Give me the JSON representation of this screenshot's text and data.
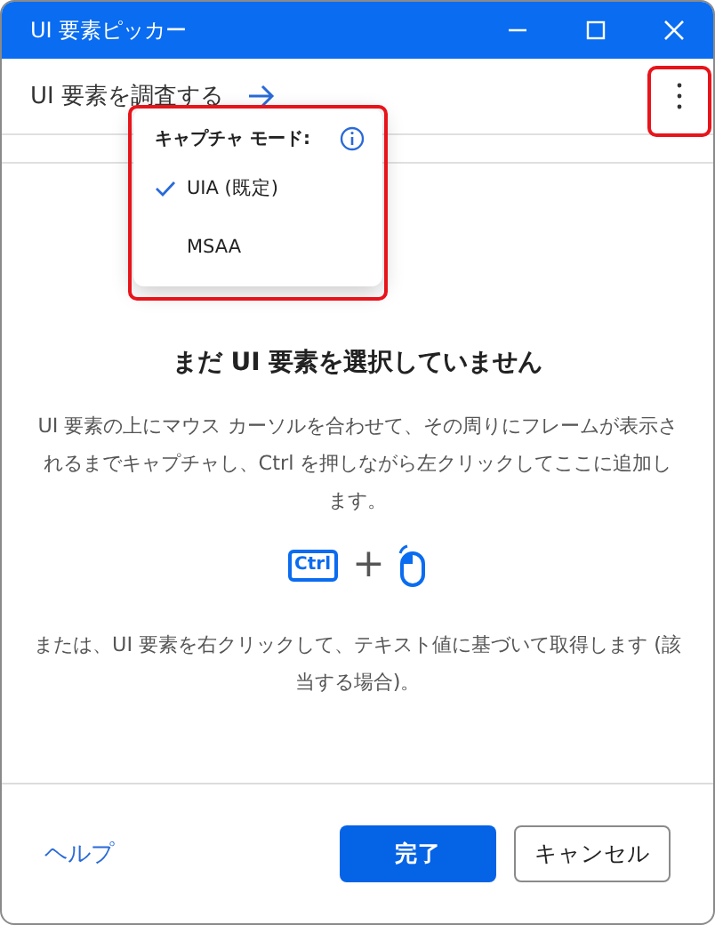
{
  "window": {
    "title": "UI 要素ピッカー"
  },
  "toolbar": {
    "inspect_link": "UI 要素を調査する"
  },
  "menu": {
    "heading": "キャプチャ モード:",
    "items": [
      {
        "label": "UIA (既定)",
        "selected": true
      },
      {
        "label": "MSAA",
        "selected": false
      }
    ]
  },
  "empty_state": {
    "title": "まだ UI 要素を選択していません",
    "instructions": "UI 要素の上にマウス カーソルを合わせて、その周りにフレームが表示されるまでキャプチャし、Ctrl を押しながら左クリックしてここに追加します。",
    "key": "Ctrl",
    "plus": "+",
    "alternative": "または、UI 要素を右クリックして、テキスト値に基づいて取得します (該当する場合)。"
  },
  "footer": {
    "help_link": "ヘルプ",
    "buttons": [
      {
        "label": "完了",
        "kind": "primary"
      },
      {
        "label": "キャンセル",
        "kind": "secondary"
      }
    ]
  }
}
